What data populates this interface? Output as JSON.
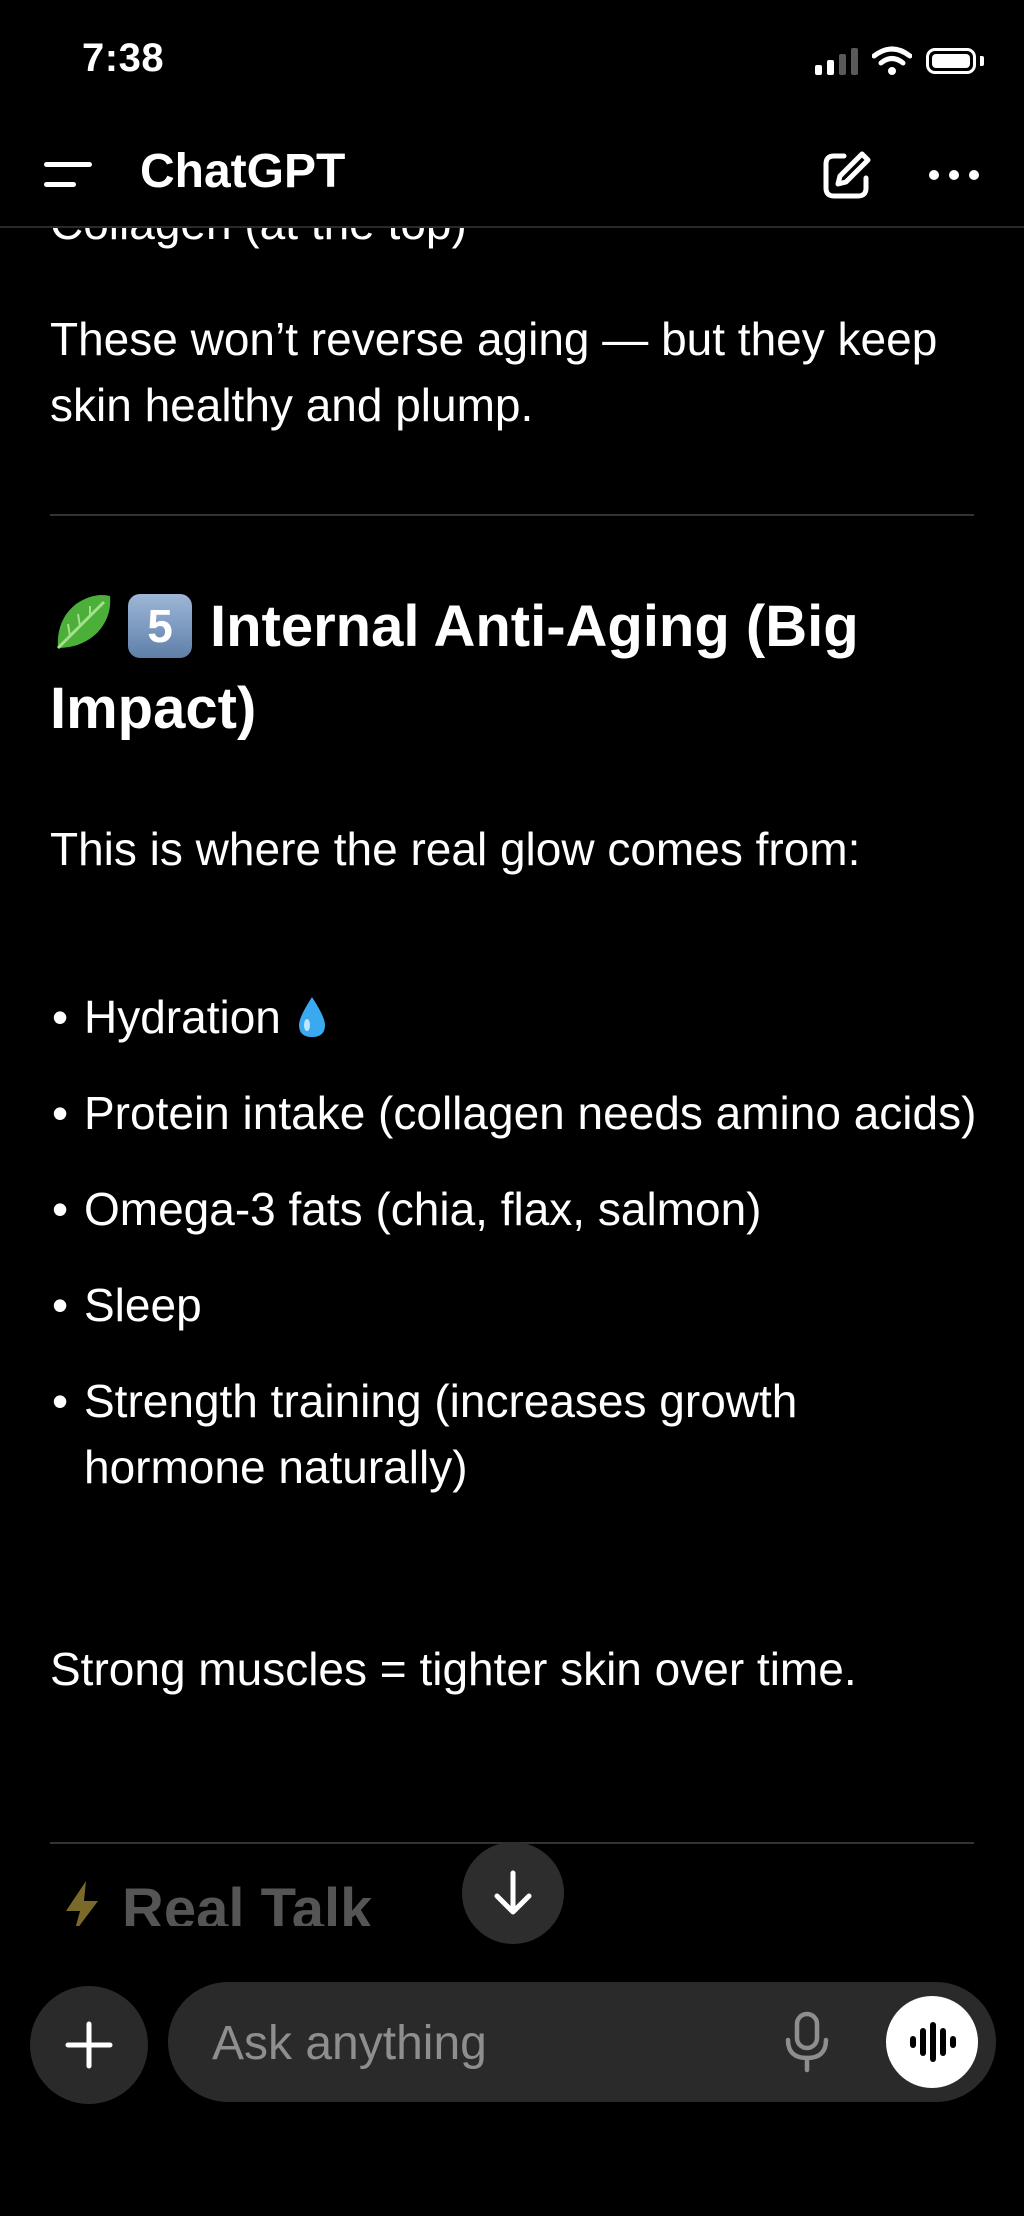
{
  "status_bar": {
    "time": "7:38"
  },
  "header": {
    "title": "ChatGPT",
    "menu_icon": "hamburger-menu-icon",
    "edit_icon": "new-chat-pencil-icon",
    "more_icon": "more-dots-icon"
  },
  "message": {
    "cut_off_line": "Collagen (at the top)",
    "intro_paragraph": "These won’t reverse aging — but they keep skin healthy and plump.",
    "section_heading": {
      "emoji": "leafy-green-icon",
      "number_badge": "5",
      "text": "Internal Anti-Aging (Big Impact)"
    },
    "lead": "This is where the real glow comes from:",
    "bullets": [
      "Hydration",
      "Protein intake (collagen needs amino acids)",
      "Omega-3 fats (chia, flax, salmon)",
      "Sleep",
      "Strength training (increases growth hormone naturally)"
    ],
    "hydration_emoji": "droplet-icon",
    "closing": "Strong muscles = tighter skin over time.",
    "next_heading": "Real Talk",
    "next_heading_emoji": "lightning-icon"
  },
  "composer": {
    "placeholder": "Ask anything",
    "plus_icon": "plus-icon",
    "mic_icon": "microphone-icon",
    "voice_icon": "voice-waveform-icon"
  },
  "scroll_button_icon": "arrow-down-icon"
}
